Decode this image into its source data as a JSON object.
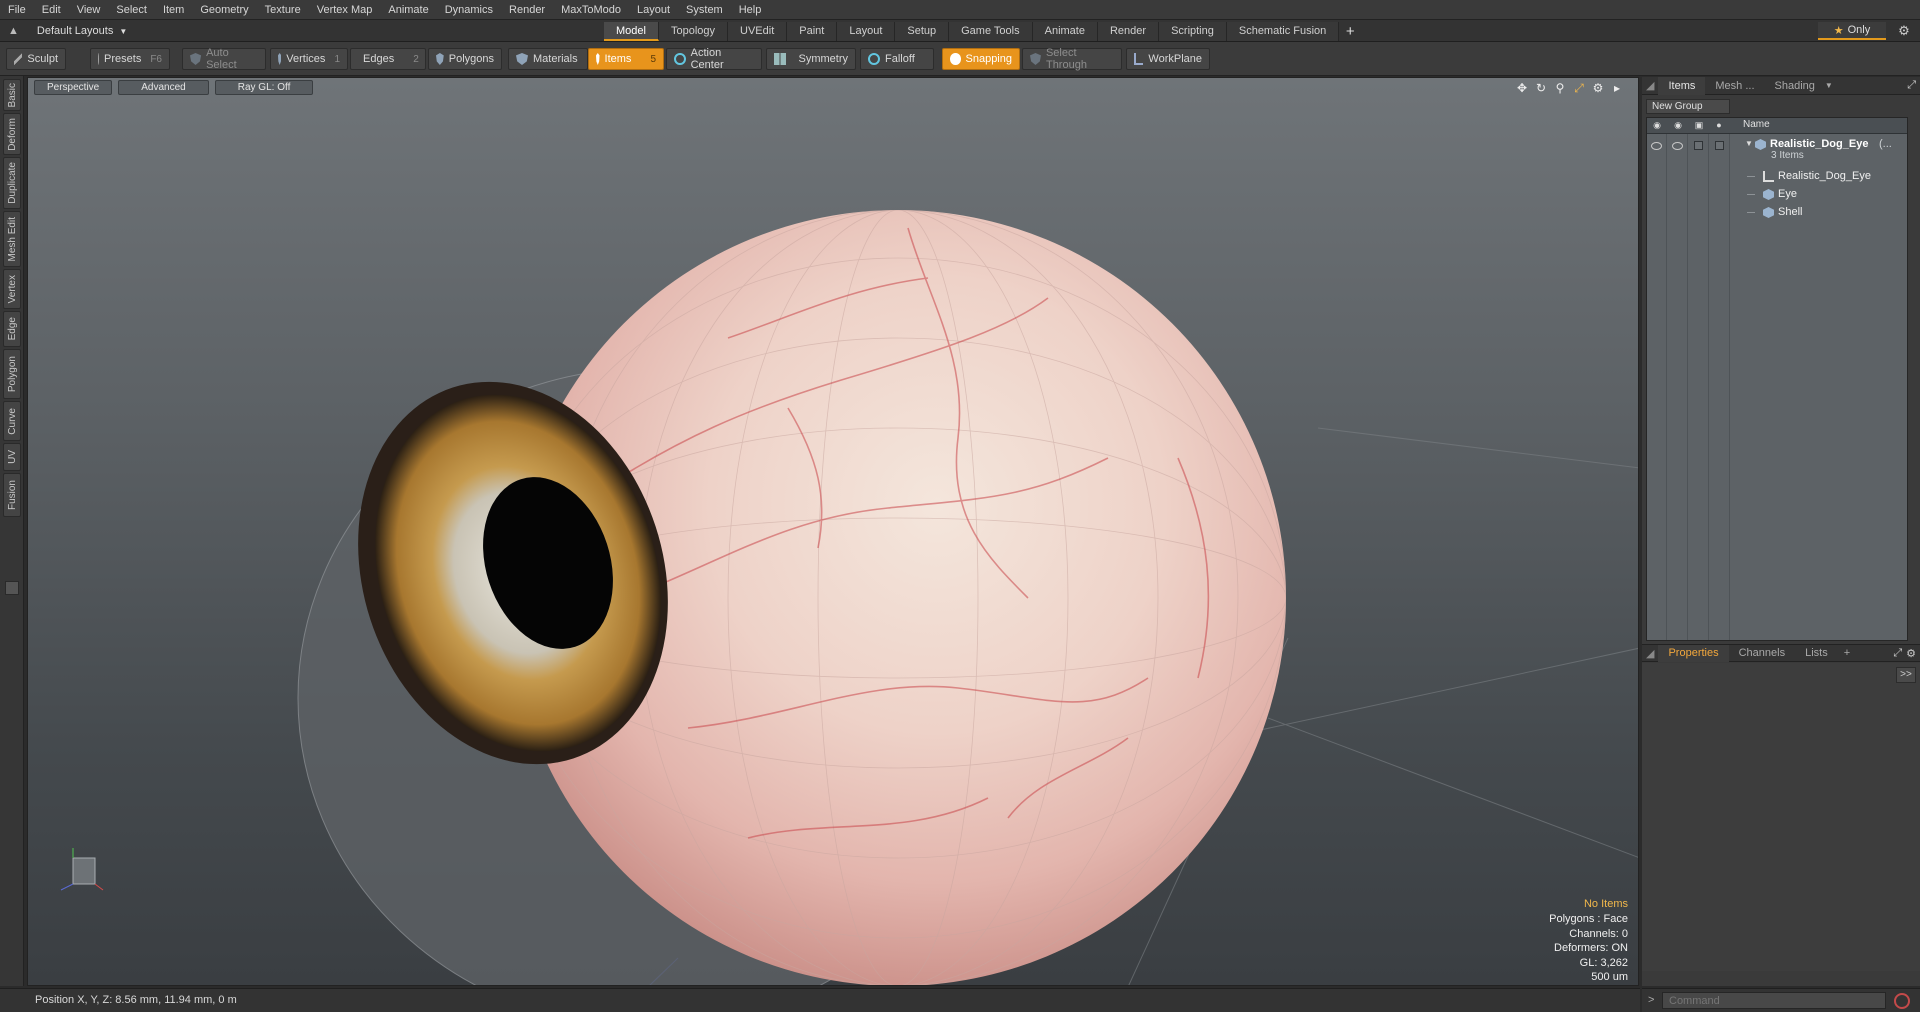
{
  "menu": [
    "File",
    "Edit",
    "View",
    "Select",
    "Item",
    "Geometry",
    "Texture",
    "Vertex Map",
    "Animate",
    "Dynamics",
    "Render",
    "MaxToModo",
    "Layout",
    "System",
    "Help"
  ],
  "layout_dropdown": "Default Layouts",
  "mode_tabs": [
    "Model",
    "Topology",
    "UVEdit",
    "Paint",
    "Layout",
    "Setup",
    "Game Tools",
    "Animate",
    "Render",
    "Scripting",
    "Schematic Fusion"
  ],
  "active_mode_tab": "Model",
  "only_label": "Only",
  "toolbar": {
    "sculpt": "Sculpt",
    "presets": "Presets",
    "presets_key": "F6",
    "auto_select": "Auto Select",
    "vertices": "Vertices",
    "vertices_key": "1",
    "edges": "Edges",
    "edges_key": "2",
    "polygons": "Polygons",
    "materials": "Materials",
    "items": "Items",
    "items_key": "5",
    "action_center": "Action Center",
    "symmetry": "Symmetry",
    "falloff": "Falloff",
    "snapping": "Snapping",
    "select_through": "Select Through",
    "workplane": "WorkPlane"
  },
  "left_tabs": [
    "Basic",
    "Deform",
    "Duplicate",
    "Mesh Edit",
    "Vertex",
    "Edge",
    "Polygon",
    "Curve",
    "UV",
    "Fusion"
  ],
  "viewport": {
    "view": "Perspective",
    "shading": "Advanced",
    "raygl": "Ray GL: Off",
    "info": {
      "selection": "No Items",
      "polygons": "Polygons : Face",
      "channels": "Channels: 0",
      "deformers": "Deformers: ON",
      "gl": "GL: 3,262",
      "scale": "500 um"
    }
  },
  "right_panel": {
    "tabs": [
      "Items",
      "Mesh ...",
      "Shading"
    ],
    "new_group": "New Group",
    "name_header": "Name",
    "items": [
      {
        "label": "Realistic_Dog_Eye",
        "suffix": "(...",
        "sub": "3 Items"
      },
      {
        "label": "Realistic_Dog_Eye"
      },
      {
        "label": "Eye"
      },
      {
        "label": "Shell"
      }
    ],
    "bottom_tabs": [
      "Properties",
      "Channels",
      "Lists"
    ],
    "expand_btn": ">>"
  },
  "status": {
    "position": "Position X, Y, Z:   8.56 mm, 11.94 mm, 0 m"
  },
  "command": {
    "placeholder": "Command"
  },
  "colors": {
    "accent": "#e8941c",
    "sclera": "#efe3d3",
    "iris": "#b98a3c",
    "veins": "#c9464a"
  }
}
